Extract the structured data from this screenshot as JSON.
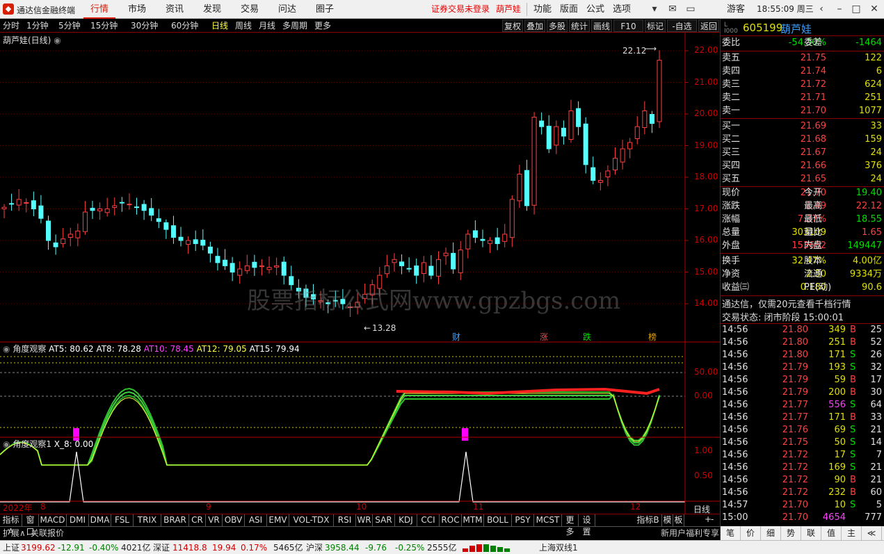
{
  "app": {
    "title": "通达信金融终端",
    "logo": "tdx-logo-icon"
  },
  "menu": [
    "行情",
    "市场",
    "资讯",
    "发现",
    "交易",
    "问达",
    "圈子"
  ],
  "login_warning": "证券交易未登录",
  "login_stock": "葫芦娃",
  "menu_right": [
    "功能",
    "版面",
    "公式",
    "选项"
  ],
  "user": "游客",
  "clock": "18:55:09 周三",
  "periods": [
    "分时",
    "1分钟",
    "5分钟",
    "15分钟",
    "30分钟",
    "60分钟",
    "日线",
    "周线",
    "月线",
    "多周期",
    "更多"
  ],
  "active_period": "日线",
  "right_tools": [
    "复权",
    "叠加",
    "多股",
    "统计",
    "画线",
    "F10",
    "标记",
    "-自选",
    "返回"
  ],
  "main": {
    "title": "葫芦娃(日线)",
    "high_label": "22.12",
    "low_label": "13.28",
    "yaxis": [
      "22.00",
      "21.00",
      "20.00",
      "19.00",
      "18.00",
      "17.00",
      "16.00",
      "15.00",
      "14.00"
    ],
    "markers": [
      "财",
      "涨",
      "跌",
      "榜"
    ]
  },
  "ind1": {
    "title": "角度观察",
    "at5": "AT5: 80.62",
    "at8": "AT8: 78.28",
    "at10": "AT10: 78.45",
    "at12": "AT12: 79.05",
    "at15": "AT15: 79.94",
    "yaxis": [
      "50.00",
      "0.00"
    ]
  },
  "ind2": {
    "title": "角度观察1",
    "x8": "X_8: 0.00",
    "yaxis": [
      "1.00",
      "0.50"
    ]
  },
  "xaxis": [
    "2022年",
    "8",
    "9",
    "10",
    "11",
    "12"
  ],
  "xaxis_right": "日线",
  "watermark": "股票指标公式网www.gpzbgs.com",
  "quote": {
    "code": "605199",
    "name": "葫芦娃",
    "wb_label": "委比",
    "wb": "-54.30%",
    "wc_label": "委差",
    "wc": "-1464",
    "sells": [
      {
        "l": "卖五",
        "p": "21.75",
        "v": "122"
      },
      {
        "l": "卖四",
        "p": "21.74",
        "v": "6"
      },
      {
        "l": "卖三",
        "p": "21.72",
        "v": "624"
      },
      {
        "l": "卖二",
        "p": "21.71",
        "v": "251"
      },
      {
        "l": "卖一",
        "p": "21.70",
        "v": "1077"
      }
    ],
    "buys": [
      {
        "l": "买一",
        "p": "21.69",
        "v": "33"
      },
      {
        "l": "买二",
        "p": "21.68",
        "v": "159"
      },
      {
        "l": "买三",
        "p": "21.67",
        "v": "24"
      },
      {
        "l": "买四",
        "p": "21.66",
        "v": "376"
      },
      {
        "l": "买五",
        "p": "21.65",
        "v": "24"
      }
    ],
    "stats": [
      {
        "l1": "现价",
        "v1": "21.70",
        "c1": "#ff4040",
        "l2": "今开",
        "v2": "19.40",
        "c2": "#00e000"
      },
      {
        "l1": "涨跌",
        "v1": "1.49",
        "c1": "#ff4040",
        "l2": "最高",
        "v2": "22.12",
        "c2": "#ff4040"
      },
      {
        "l1": "涨幅",
        "v1": "7.37%",
        "c1": "#ff4040",
        "l2": "最低",
        "v2": "18.55",
        "c2": "#00e000"
      },
      {
        "l1": "总量",
        "v1": "303109",
        "c1": "#e0e000",
        "l2": "量比",
        "v2": "1.65",
        "c2": "#ff4040"
      },
      {
        "l1": "外盘",
        "v1": "153662",
        "c1": "#ff4040",
        "l2": "内盘",
        "v2": "149447",
        "c2": "#00e000"
      }
    ],
    "stats2": [
      {
        "l1": "换手",
        "v1": "32.47%",
        "l2": "股本",
        "v2": "4.00亿"
      },
      {
        "l1": "净资",
        "v1": "2.50",
        "l2": "流通",
        "v2": "9334万"
      },
      {
        "l1": "收益㈢",
        "v1": "0.180",
        "l2": "PE(动)",
        "v2": "90.6"
      }
    ],
    "promo": "通达信，仅需20元查看千档行情",
    "state": "交易状态: 闭市阶段 15:00:01",
    "ticks": [
      [
        "14:56",
        "21.80",
        "349",
        "B",
        "25"
      ],
      [
        "14:56",
        "21.80",
        "251",
        "B",
        "52"
      ],
      [
        "14:56",
        "21.80",
        "171",
        "S",
        "26"
      ],
      [
        "14:56",
        "21.79",
        "193",
        "S",
        "32"
      ],
      [
        "14:56",
        "21.79",
        "59",
        "B",
        "17"
      ],
      [
        "14:56",
        "21.79",
        "200",
        "B",
        "30"
      ],
      [
        "14:56",
        "21.77",
        "556",
        "S",
        "64"
      ],
      [
        "14:56",
        "21.77",
        "171",
        "B",
        "33"
      ],
      [
        "14:56",
        "21.76",
        "69",
        "S",
        "21"
      ],
      [
        "14:56",
        "21.75",
        "50",
        "S",
        "14"
      ],
      [
        "14:56",
        "21.72",
        "17",
        "S",
        "7"
      ],
      [
        "14:56",
        "21.72",
        "169",
        "S",
        "21"
      ],
      [
        "14:56",
        "21.72",
        "90",
        "B",
        "21"
      ],
      [
        "14:56",
        "21.72",
        "232",
        "B",
        "60"
      ],
      [
        "14:57",
        "21.70",
        "10",
        "S",
        "5"
      ],
      [
        "15:00",
        "21.70",
        "4654",
        "",
        "777"
      ]
    ]
  },
  "bottom_tabs": [
    "指标A",
    "窗口",
    "MACD",
    "DMI",
    "DMA",
    "FSL",
    "TRIX",
    "BRAR",
    "CR",
    "VR",
    "OBV",
    "ASI",
    "EMV",
    "VOL-TDX",
    "RSI",
    "WR",
    "SAR",
    "KDJ",
    "CCI",
    "ROC",
    "MTM",
    "BOLL",
    "PSY",
    "MCST",
    "更多",
    "设置"
  ],
  "bottom_right": [
    "指标B",
    "模",
    "板"
  ],
  "rp_tabs": [
    "+",
    "-"
  ],
  "ext": [
    "扩展∧",
    "关联报价"
  ],
  "rp_tabs2": [
    "笔",
    "价",
    "细",
    "势",
    "联",
    "值",
    "主",
    "≪"
  ],
  "newuser": "新用户福利专享",
  "status": {
    "sh_label": "上证",
    "sh": "3199.62",
    "sh_chg": "-12.91",
    "sh_pct": "-0.40%",
    "sh_amt": "4021亿",
    "sz_label": "深证",
    "sz": "11418.8",
    "sz_chg": "19.94",
    "sz_pct": "0.17%",
    "sz_amt": "5465亿",
    "hs_label": "沪深",
    "hs": "3958.44",
    "hs_chg": "-9.76",
    "hs_pct": "-0.25%",
    "hs_amt": "2555亿",
    "line": "上海双线1"
  }
}
